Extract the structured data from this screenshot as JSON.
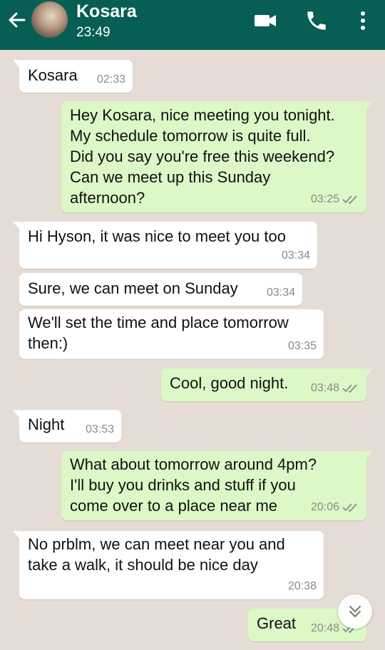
{
  "header": {
    "contact_name": "Kosara",
    "last_seen": "23:49"
  },
  "icons": {
    "back": "arrow-left-icon",
    "video": "video-camera-icon",
    "call": "phone-icon",
    "menu": "more-vertical-icon",
    "scroll": "double-chevron-down-icon",
    "read": "double-check-icon"
  },
  "colors": {
    "header": "#075e54",
    "background": "#e5ddd5",
    "incoming": "#ffffff",
    "outgoing": "#dcf8c6"
  },
  "messages": [
    {
      "dir": "in",
      "text": "Kosara",
      "time": "02:33"
    },
    {
      "dir": "out",
      "text": "Hey Kosara, nice meeting you tonight.\nMy schedule tomorrow is quite full.\nDid you say you're free this weekend?\nCan we meet up this Sunday\nafternoon?",
      "time": "03:25"
    },
    {
      "dir": "in",
      "text": "Hi Hyson, it was nice to meet you too",
      "time": "03:34"
    },
    {
      "dir": "in",
      "text": "Sure, we can meet on Sunday",
      "time": "03:34"
    },
    {
      "dir": "in",
      "text": "We'll set the time and place tomorrow\nthen:)",
      "time": "03:35"
    },
    {
      "dir": "out",
      "text": "Cool, good night.",
      "time": "03:48"
    },
    {
      "dir": "in",
      "text": "Night",
      "time": "03:53"
    },
    {
      "dir": "out",
      "text": "What about tomorrow around 4pm?\nI'll buy you drinks and stuff if you\ncome over to a place near me",
      "time": "20:06"
    },
    {
      "dir": "in",
      "text": "No prblm, we can meet near you and\ntake a walk, it should be nice day",
      "time": "20:38"
    },
    {
      "dir": "out",
      "text": "Great",
      "time": "20:48"
    }
  ]
}
